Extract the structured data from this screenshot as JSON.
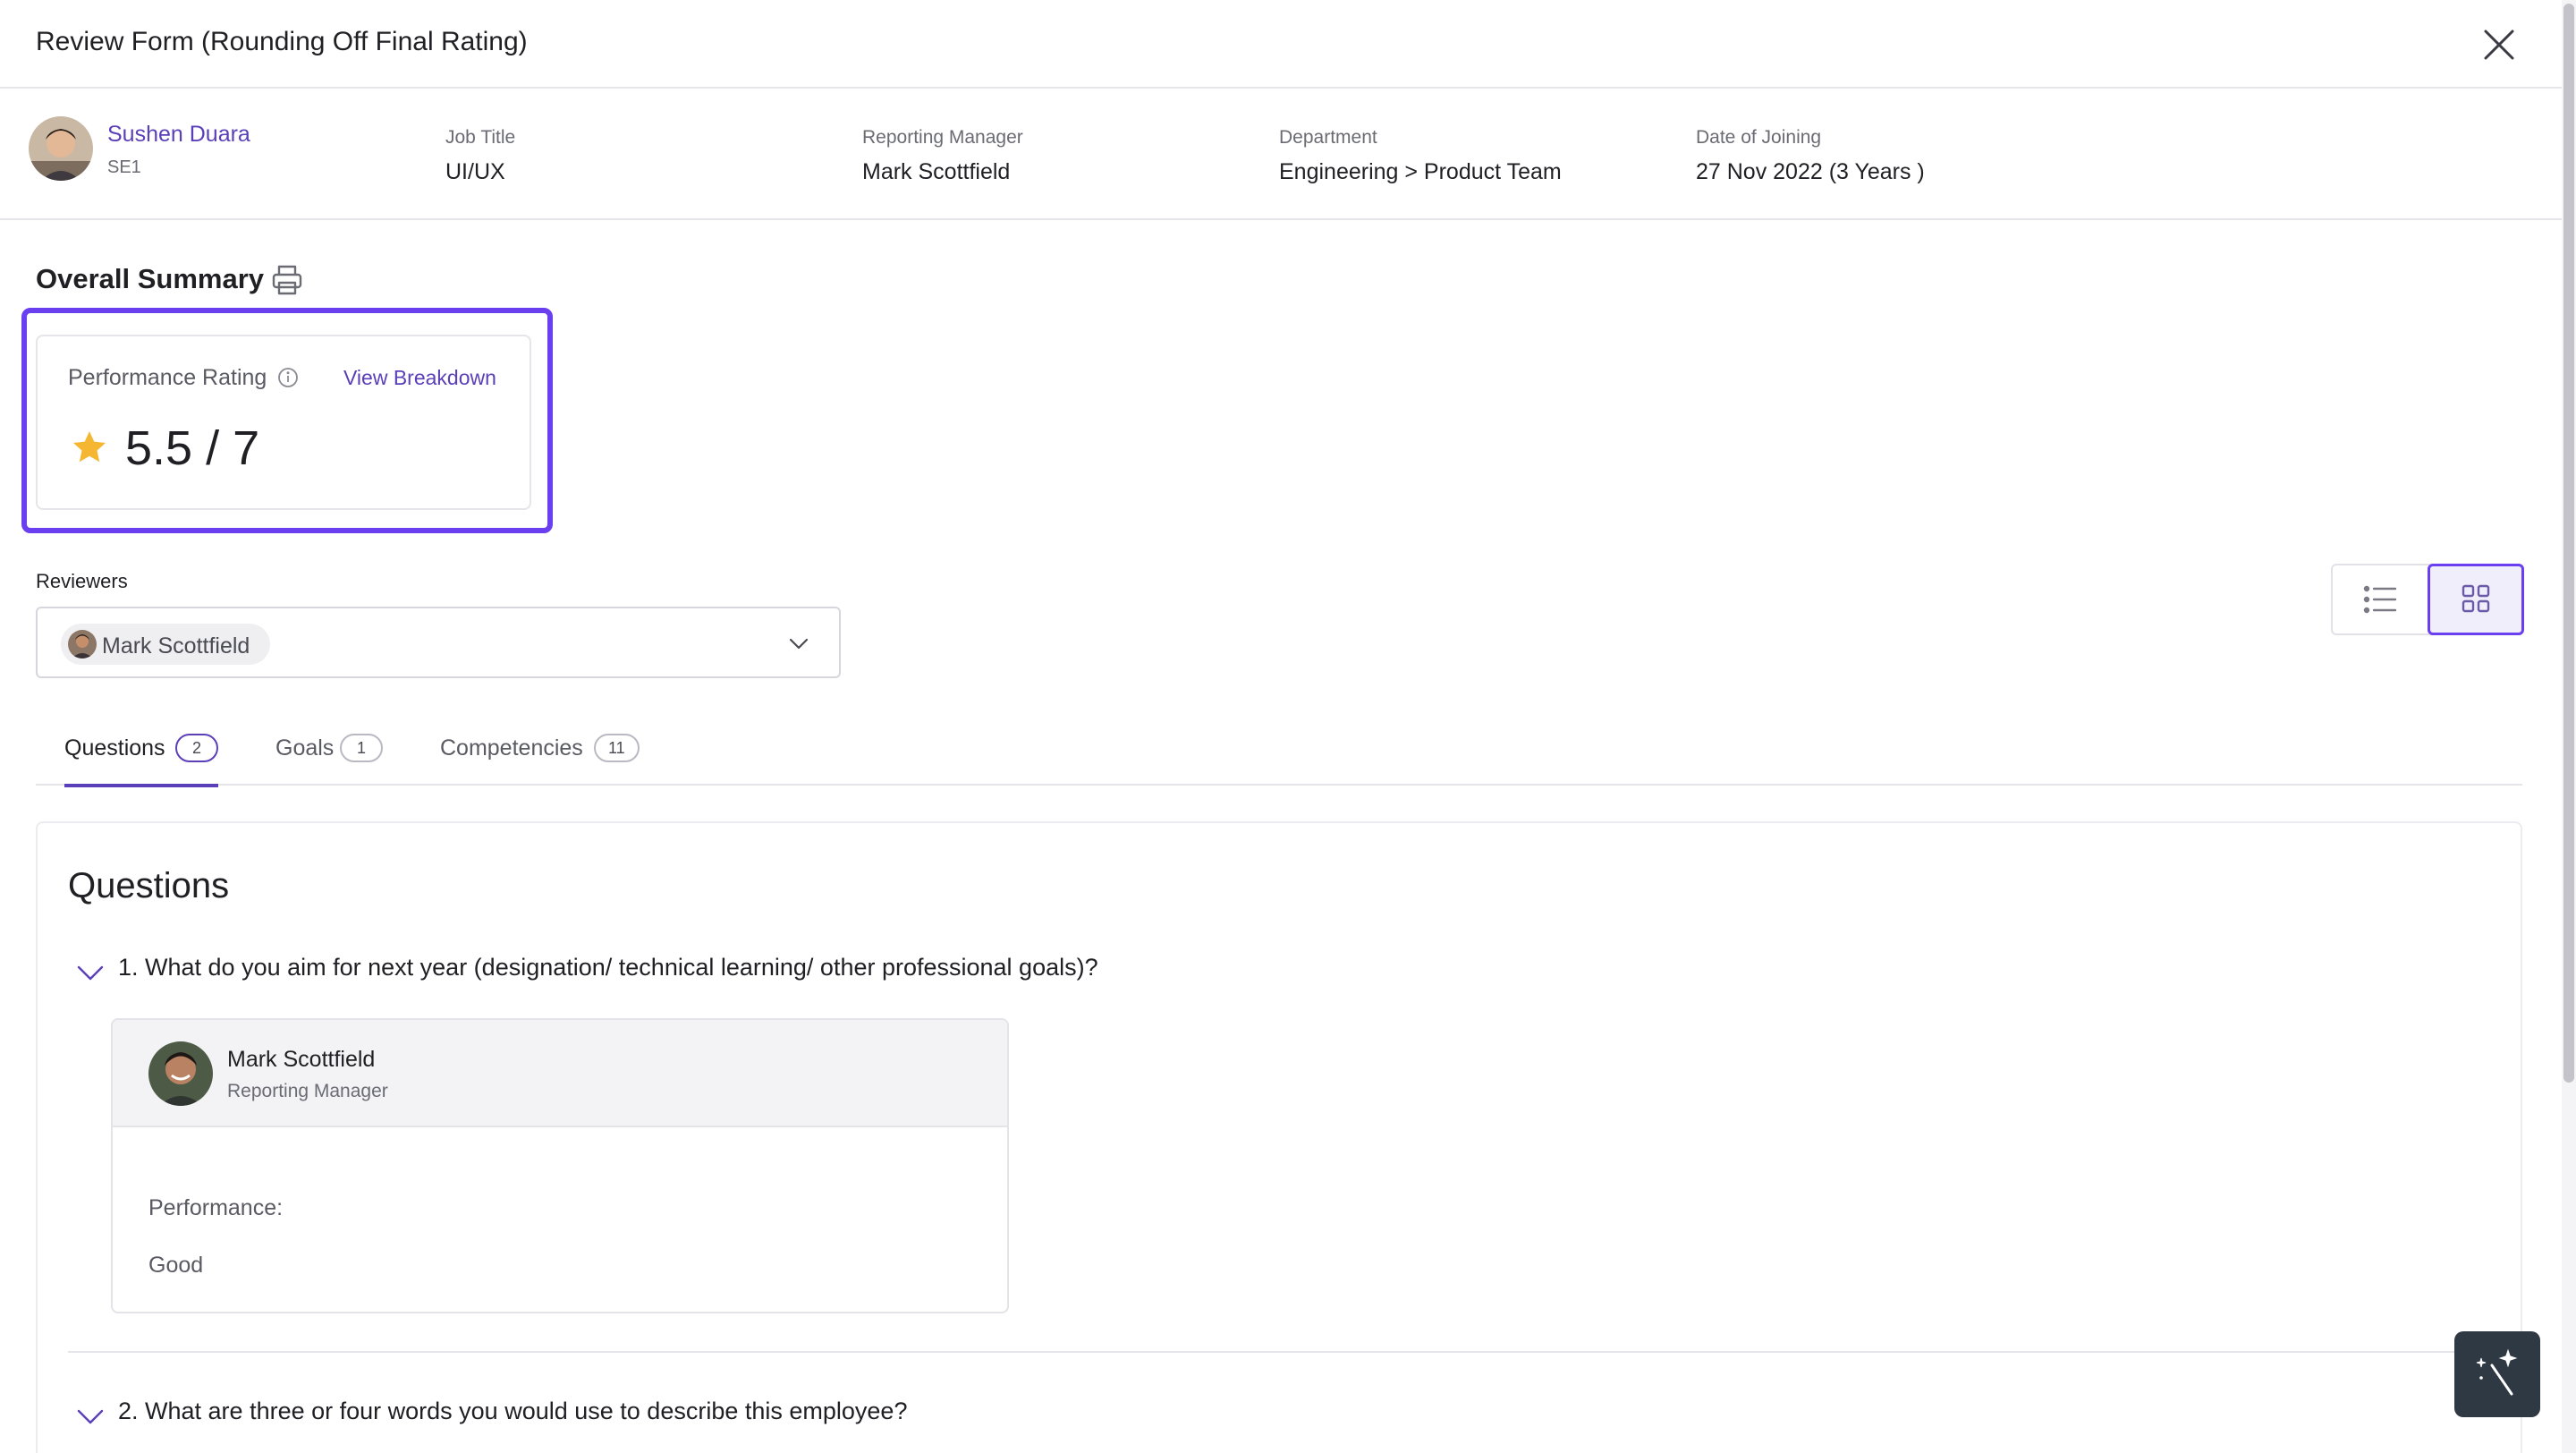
{
  "header": {
    "title": "Review Form (Rounding Off Final Rating)",
    "close_icon": "close-icon"
  },
  "employee": {
    "name": "Sushen Duara",
    "grade": "SE1",
    "meta": [
      {
        "label": "Job Title",
        "value": "UI/UX"
      },
      {
        "label": "Reporting Manager",
        "value": "Mark Scottfield"
      },
      {
        "label": "Department",
        "value": "Engineering > Product Team"
      },
      {
        "label": "Date of Joining",
        "value": "27 Nov 2022 (3 Years )"
      }
    ]
  },
  "summary": {
    "title": "Overall Summary",
    "print_icon": "printer-icon",
    "rating_label": "Performance Rating",
    "view_breakdown": "View Breakdown",
    "rating_value": "5.5 / 7",
    "star_color": "#f5b731"
  },
  "reviewers": {
    "label": "Reviewers",
    "selected": [
      "Mark Scottfield"
    ]
  },
  "view_toggle": {
    "options": [
      "list-view-icon",
      "grid-view-icon"
    ],
    "active": "grid-view-icon"
  },
  "tabs": [
    {
      "label": "Questions",
      "count": "2",
      "active": true
    },
    {
      "label": "Goals",
      "count": "1",
      "active": false
    },
    {
      "label": "Competencies",
      "count": "11",
      "active": false
    }
  ],
  "questions": {
    "heading": "Questions",
    "items": [
      {
        "text": "1. What do you aim for next year (designation/ technical learning/ other professional goals)?",
        "answer": {
          "reviewer": "Mark Scottfield",
          "role": "Reporting Manager",
          "label": "Performance:",
          "value": "Good"
        }
      },
      {
        "text": "2. What are three or four words you would use to describe this employee?"
      }
    ]
  },
  "colors": {
    "accent": "#5b3fb8",
    "highlight": "#6a3ff0",
    "fab_background": "#2f3944"
  }
}
